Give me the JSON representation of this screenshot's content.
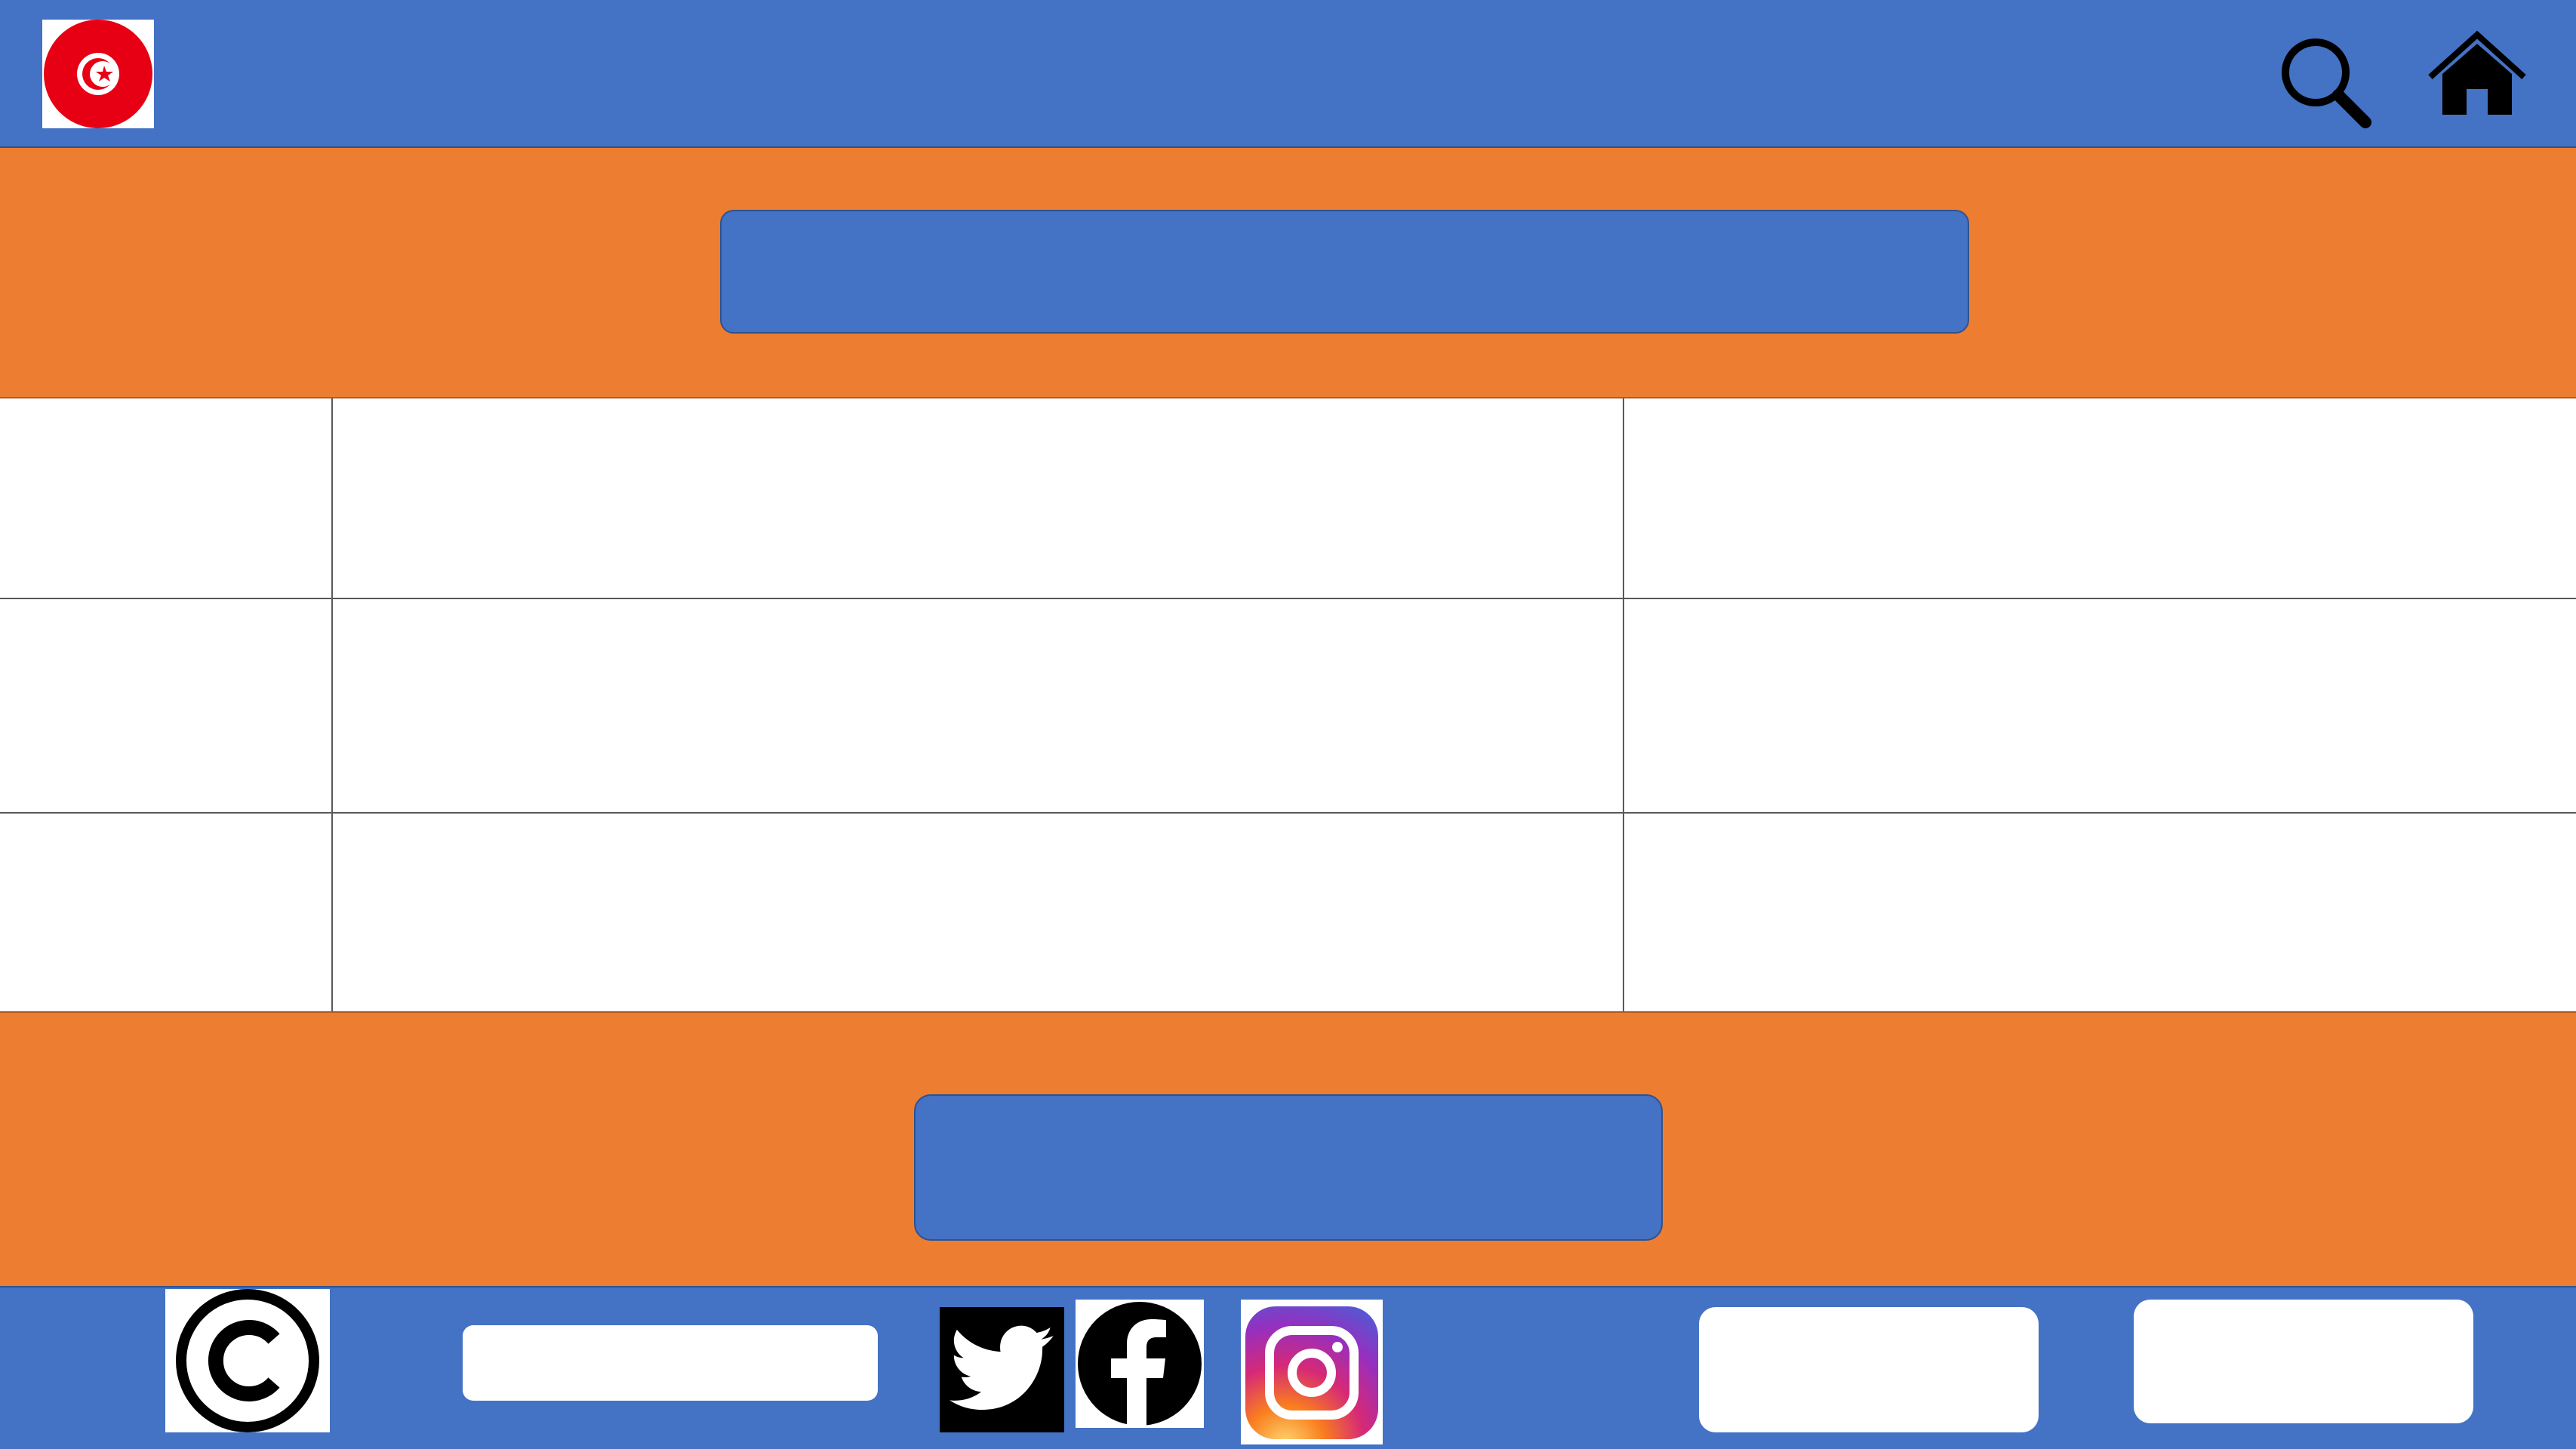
{
  "colors": {
    "header_blue": "#4472c4",
    "accent_orange": "#ed7d31",
    "flag_red": "#e70013",
    "white": "#ffffff"
  },
  "header": {
    "logo_icon": "tunisia-flag-icon",
    "search_icon": "search-icon",
    "home_icon": "home-icon"
  },
  "banner": {
    "title": ""
  },
  "grid": {
    "rows": [
      [
        "",
        "",
        ""
      ],
      [
        "",
        "",
        ""
      ],
      [
        "",
        "",
        ""
      ]
    ]
  },
  "lower": {
    "button_label": ""
  },
  "footer": {
    "copyright_icon": "copyright-icon",
    "input_value": "",
    "social_icons": [
      "twitter-icon",
      "facebook-icon",
      "instagram-icon"
    ],
    "button_1_label": "",
    "button_2_label": ""
  }
}
